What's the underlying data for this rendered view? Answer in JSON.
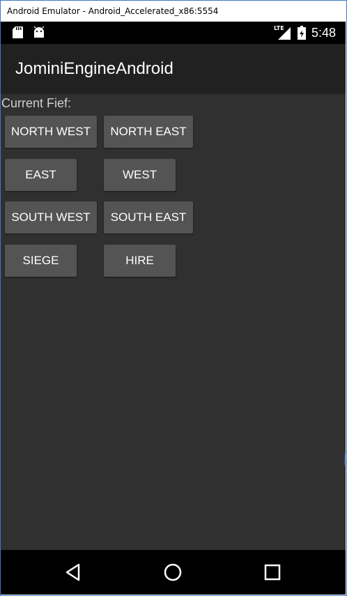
{
  "window": {
    "title": "Android Emulator - Android_Accelerated_x86:5554"
  },
  "status_bar": {
    "network_label": "LTE",
    "time": "5:48",
    "icons": [
      "sd-card-icon",
      "android-icon",
      "signal-icon",
      "battery-icon"
    ]
  },
  "app_bar": {
    "title": "JominiEngineAndroid",
    "background": "#212121"
  },
  "content": {
    "current_fief_label": "Current Fief:",
    "background": "#303030",
    "buttons": {
      "north_west": "NORTH WEST",
      "north_east": "NORTH EAST",
      "east": "EAST",
      "west": "WEST",
      "south_west": "SOUTH WEST",
      "south_east": "SOUTH EAST",
      "siege": "SIEGE",
      "hire": "HIRE"
    },
    "button_color": "#545454"
  },
  "nav_bar": {
    "icons": [
      "back-icon",
      "home-icon",
      "recents-icon"
    ]
  }
}
